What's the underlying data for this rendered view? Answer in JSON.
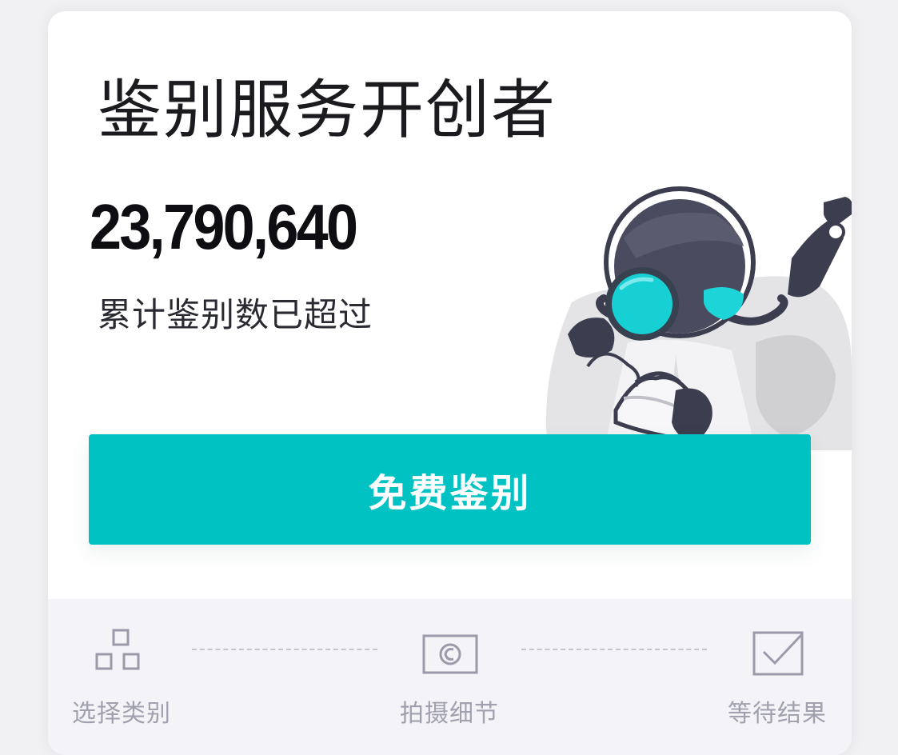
{
  "header": {
    "title": "鉴别服务开创者",
    "count": "23,790,640",
    "subtitle": "累计鉴别数已超过"
  },
  "cta": {
    "label": "免费鉴别"
  },
  "steps": [
    {
      "label": "选择类别",
      "icon": "category-grid-icon"
    },
    {
      "label": "拍摄细节",
      "icon": "camera-icon"
    },
    {
      "label": "等待结果",
      "icon": "checkbox-icon"
    }
  ],
  "colors": {
    "accent": "#00c2c3",
    "step_icon": "#9b9aaa",
    "step_label": "#a0a0ae",
    "steps_background": "#f4f4f8"
  }
}
